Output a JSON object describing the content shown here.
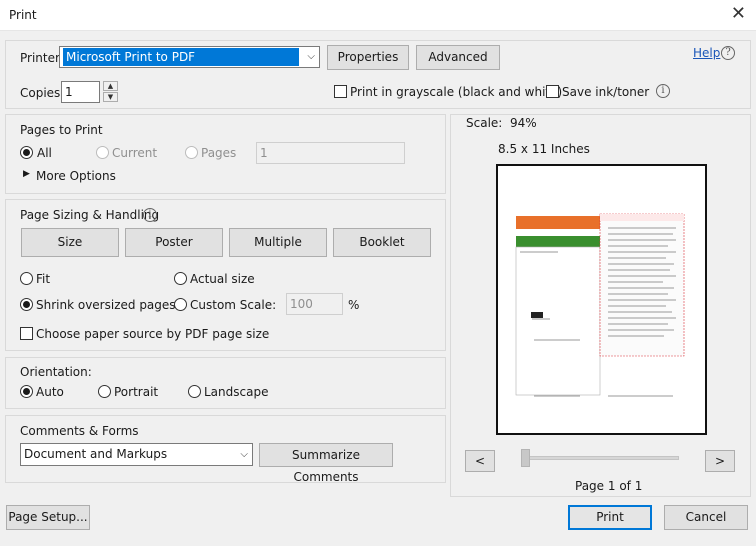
{
  "window": {
    "title": "Print",
    "close_glyph": "✕"
  },
  "printer": {
    "label": "Printer:",
    "selected": "Microsoft Print to PDF",
    "properties_label": "Properties",
    "advanced_label": "Advanced",
    "help_label": "Help"
  },
  "copies": {
    "label": "Copies:",
    "value": "1"
  },
  "options": {
    "grayscale_label": "Print in grayscale (black and white)",
    "grayscale_checked": false,
    "save_ink_label": "Save ink/toner",
    "save_ink_checked": false
  },
  "pages_to_print": {
    "heading": "Pages to Print",
    "all_label": "All",
    "current_label": "Current",
    "pages_label": "Pages",
    "pages_value": "1",
    "selected": "All",
    "more_options_label": "More Options"
  },
  "sizing": {
    "heading": "Page Sizing & Handling",
    "tabs": [
      "Size",
      "Poster",
      "Multiple",
      "Booklet"
    ],
    "fit_label": "Fit",
    "actual_size_label": "Actual size",
    "shrink_label": "Shrink oversized pages",
    "custom_scale_label": "Custom Scale:",
    "custom_scale_value": "100",
    "percent_label": "%",
    "paper_source_label": "Choose paper source by PDF page size",
    "selected": "Shrink oversized pages"
  },
  "orientation": {
    "heading": "Orientation:",
    "auto_label": "Auto",
    "portrait_label": "Portrait",
    "landscape_label": "Landscape",
    "selected": "Auto"
  },
  "comments": {
    "heading": "Comments & Forms",
    "selected": "Document and Markups",
    "summarize_label": "Summarize Comments"
  },
  "preview": {
    "scale_text": "Scale:  94%",
    "paper_size": "8.5 x 11 Inches",
    "prev_label": "<",
    "next_label": ">",
    "page_indicator": "Page 1 of 1"
  },
  "footer": {
    "page_setup_label": "Page Setup...",
    "print_label": "Print",
    "cancel_label": "Cancel"
  },
  "colors": {
    "accent": "#0078d7",
    "link": "#1a56b8",
    "preview_orange": "#e8702a",
    "preview_green": "#3a8f2e",
    "preview_red": "#d9333a"
  }
}
